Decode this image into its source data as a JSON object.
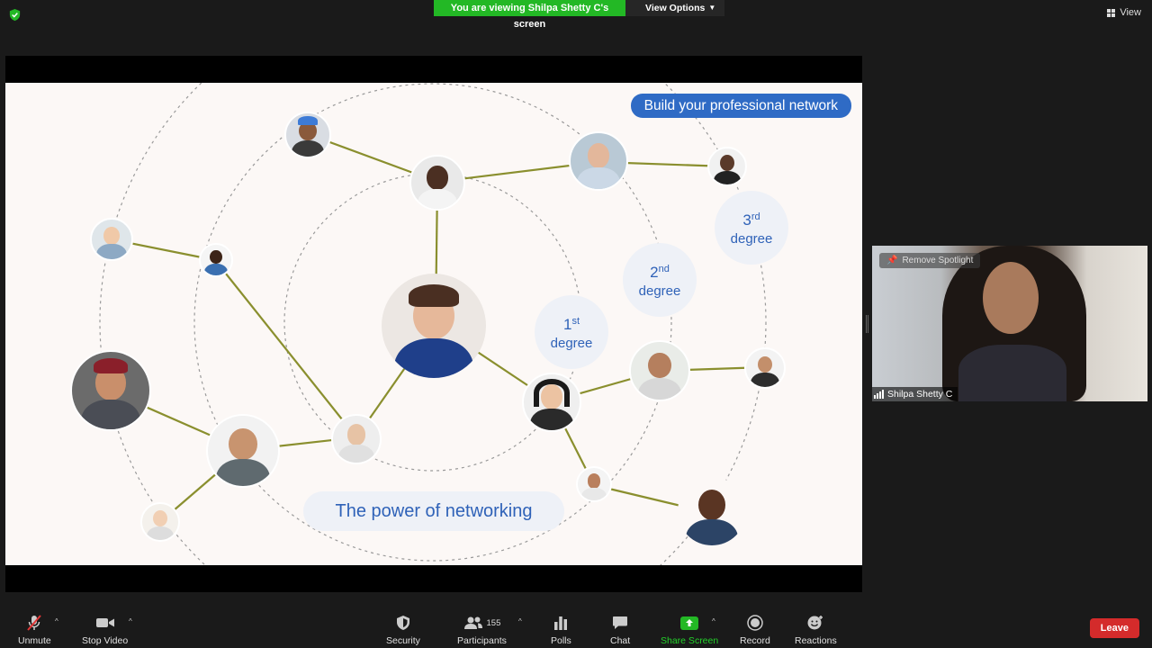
{
  "top": {
    "banner": "You are viewing Shilpa Shetty C's screen",
    "view_options": "View Options",
    "view": "View"
  },
  "slide": {
    "pill": "Build your professional network",
    "degrees": [
      {
        "num": "1",
        "sup": "st",
        "word": "degree"
      },
      {
        "num": "2",
        "sup": "nd",
        "word": "degree"
      },
      {
        "num": "3",
        "sup": "rd",
        "word": "degree"
      }
    ],
    "power": "The power of networking"
  },
  "tile": {
    "remove_spotlight": "Remove Spotlight",
    "name": "Shilpa Shetty C"
  },
  "toolbar": {
    "unmute": "Unmute",
    "stop_video": "Stop Video",
    "security": "Security",
    "participants": "Participants",
    "participants_count": "155",
    "polls": "Polls",
    "chat": "Chat",
    "share_screen": "Share Screen",
    "record": "Record",
    "reactions": "Reactions",
    "leave": "Leave"
  },
  "colors": {
    "share_green": "#23b825",
    "slide_blue": "#2f6bc5",
    "line_olive": "#8a8f2e",
    "leave_red": "#d42b2b"
  }
}
